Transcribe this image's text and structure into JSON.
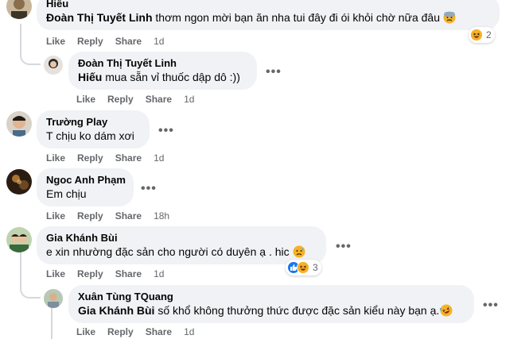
{
  "comments": [
    {
      "author": "Hiếu",
      "mention": "Đoàn Thị Tuyết Linh",
      "text": " thơm ngon mời bạn ăn nha tui đây đi ói khỏi chờ nữa đâu",
      "inline_emoji": "anxious-face-with-sweat-icon",
      "reaction_count": "2",
      "reaction_icons": [
        "laughing-face-icon"
      ],
      "actions": {
        "like": "Like",
        "reply": "Reply",
        "share": "Share",
        "time": "1d"
      }
    },
    {
      "author": "Đoàn Thị Tuyết Linh",
      "mention": "Hiếu",
      "text": " mua sẵn vỉ thuốc dập dô :))",
      "actions": {
        "like": "Like",
        "reply": "Reply",
        "share": "Share",
        "time": "1d"
      }
    },
    {
      "author": "Trường Play",
      "text": "T chịu ko dám xơi",
      "actions": {
        "like": "Like",
        "reply": "Reply",
        "share": "Share",
        "time": "1d"
      }
    },
    {
      "author": "Ngoc Anh Phạm",
      "text": "Em chịu",
      "actions": {
        "like": "Like",
        "reply": "Reply",
        "share": "Share",
        "time": "18h"
      }
    },
    {
      "author": "Gia Khánh Bùi",
      "text": "e xin nhường đặc sản cho người có duyên ạ . hic",
      "inline_emoji": "sad-sweat-face-icon",
      "reaction_count": "3",
      "reaction_icons": [
        "like-icon",
        "laughing-face-icon"
      ],
      "actions": {
        "like": "Like",
        "reply": "Reply",
        "share": "Share",
        "time": "1d"
      }
    },
    {
      "author": "Xuân Tùng TQuang",
      "mention": "Gia Khánh Bùi",
      "text": " số khổ không thưởng thức được đặc sản kiểu này bạn ạ.",
      "inline_emoji": "rolling-laughing-face-icon",
      "actions": {
        "like": "Like",
        "reply": "Reply",
        "share": "Share",
        "time": "1d"
      }
    }
  ],
  "more_label": "•••",
  "colors": {
    "bubble": "#f0f2f5",
    "secondary_text": "#65676b",
    "like_blue": "#1877f2",
    "emoji_yellow": "#f7b125"
  }
}
